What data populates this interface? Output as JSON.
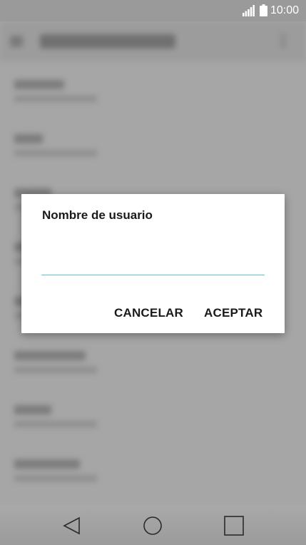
{
  "status_bar": {
    "time": "10:00",
    "icons": [
      "signal-icon",
      "battery-icon"
    ],
    "text_color": "#ffffff"
  },
  "dialog": {
    "title": "Nombre de usuario",
    "input": {
      "value": "",
      "placeholder": ""
    },
    "buttons": {
      "cancel_label": "CANCELAR",
      "accept_label": "ACEPTAR"
    },
    "accent_color": "#5fc7c9"
  },
  "navigation_bar": {
    "icons": [
      "back-icon",
      "home-icon",
      "recents-icon"
    ]
  }
}
